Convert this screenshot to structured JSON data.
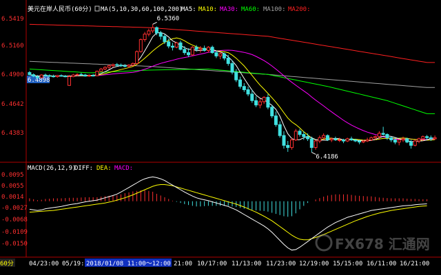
{
  "header": {
    "symbol": "美元在岸人民币(60分)",
    "ma_title": "MA(5,10,30,60,100,200)",
    "ma_entries": [
      {
        "label": "MA5:",
        "color": "#ffffff"
      },
      {
        "label": "MA10:",
        "color": "#ffff00"
      },
      {
        "label": "MA30:",
        "color": "#ff00ff"
      },
      {
        "label": "MA60:",
        "color": "#00ff00"
      },
      {
        "label": "MA100:",
        "color": "#a0a0a0"
      },
      {
        "label": "MA200:",
        "color": "#ff2020"
      }
    ]
  },
  "macd_header": {
    "title": "MACD(26,12,9)",
    "diff_label": "DIFF:",
    "dea_label": "DEA:",
    "macd_label": "MACD:"
  },
  "colors": {
    "up": "#ff3030",
    "down": "#40e0e0",
    "axis": "#b00000",
    "ma5": "#ffffff",
    "ma10": "#ffff00",
    "ma30": "#ff00ff",
    "ma60": "#00ff00",
    "ma100": "#a0a0a0",
    "ma200": "#ff2020",
    "diff": "#ffffff",
    "dea": "#ffff00"
  },
  "chart_data": [
    {
      "type": "candlestick",
      "title": "美元在岸人民币(60分)",
      "ylim": [
        6.412,
        6.5419
      ],
      "yticks": [
        "6.5419",
        "6.5160",
        "6.4900",
        "6.4642",
        "6.4383"
      ],
      "current_price_label": "6.4898",
      "annotations": [
        {
          "text": "6.5360",
          "x_index": 31,
          "value": 6.536,
          "type": "high"
        },
        {
          "text": "6.4186",
          "x_index": 71,
          "value": 6.4186,
          "type": "low"
        }
      ],
      "candles": [
        [
          6.4918,
          6.4932,
          6.4895,
          6.4898
        ],
        [
          6.4898,
          6.491,
          6.4875,
          6.4885
        ],
        [
          6.488,
          6.4895,
          6.486,
          6.487
        ],
        [
          6.487,
          6.4902,
          6.4865,
          6.4895
        ],
        [
          6.4895,
          6.4908,
          6.488,
          6.489
        ],
        [
          6.489,
          6.49,
          6.4878,
          6.4885
        ],
        [
          6.4885,
          6.4898,
          6.4872,
          6.488
        ],
        [
          6.488,
          6.4895,
          6.487,
          6.489
        ],
        [
          6.489,
          6.49,
          6.488,
          6.4885
        ],
        [
          6.4885,
          6.4895,
          6.4875,
          6.488
        ],
        [
          6.48,
          6.4895,
          6.4795,
          6.488
        ],
        [
          6.488,
          6.4905,
          6.4875,
          6.4895
        ],
        [
          6.4895,
          6.491,
          6.4885,
          6.49
        ],
        [
          6.49,
          6.4915,
          6.4888,
          6.4895
        ],
        [
          6.4895,
          6.4905,
          6.488,
          6.4885
        ],
        [
          6.4885,
          6.49,
          6.4878,
          6.4892
        ],
        [
          6.4892,
          6.4905,
          6.4882,
          6.4888
        ],
        [
          6.4888,
          6.4935,
          6.4885,
          6.493
        ],
        [
          6.493,
          6.496,
          6.4925,
          6.495
        ],
        [
          6.495,
          6.4975,
          6.494,
          6.4965
        ],
        [
          6.4965,
          6.499,
          6.495,
          6.498
        ],
        [
          6.498,
          6.5,
          6.4965,
          6.499
        ],
        [
          6.499,
          6.5005,
          6.497,
          6.4985
        ],
        [
          6.4985,
          6.5,
          6.497,
          6.498
        ],
        [
          6.498,
          6.4995,
          6.4965,
          6.4975
        ],
        [
          6.4975,
          6.4995,
          6.496,
          6.4985
        ],
        [
          6.4985,
          6.501,
          6.4975,
          6.5
        ],
        [
          6.5,
          6.512,
          6.4995,
          6.511
        ],
        [
          6.511,
          6.523,
          6.51,
          6.522
        ],
        [
          6.522,
          6.529,
          6.52,
          6.527
        ],
        [
          6.527,
          6.532,
          6.525,
          6.53
        ],
        [
          6.53,
          6.536,
          6.528,
          6.533
        ],
        [
          6.533,
          6.534,
          6.526,
          6.528
        ],
        [
          6.528,
          6.53,
          6.522,
          6.525
        ],
        [
          6.525,
          6.527,
          6.518,
          6.52
        ],
        [
          6.52,
          6.523,
          6.514,
          6.516
        ],
        [
          6.516,
          6.519,
          6.512,
          6.515
        ],
        [
          6.515,
          6.52,
          6.514,
          6.519
        ],
        [
          6.519,
          6.521,
          6.512,
          6.513
        ],
        [
          6.513,
          6.516,
          6.508,
          6.51
        ],
        [
          6.51,
          6.514,
          6.506,
          6.508
        ],
        [
          6.508,
          6.516,
          6.507,
          6.515
        ],
        [
          6.515,
          6.517,
          6.511,
          6.513
        ],
        [
          6.513,
          6.516,
          6.51,
          6.514
        ],
        [
          6.514,
          6.5165,
          6.511,
          6.512
        ],
        [
          6.512,
          6.516,
          6.51,
          6.515
        ],
        [
          6.515,
          6.5165,
          6.509,
          6.51
        ],
        [
          6.51,
          6.512,
          6.505,
          6.507
        ],
        [
          6.507,
          6.511,
          6.504,
          6.509
        ],
        [
          6.509,
          6.51,
          6.503,
          6.505
        ],
        [
          6.505,
          6.508,
          6.498,
          6.5
        ],
        [
          6.5,
          6.503,
          6.49,
          6.492
        ],
        [
          6.492,
          6.495,
          6.483,
          6.485
        ],
        [
          6.485,
          6.488,
          6.477,
          6.479
        ],
        [
          6.479,
          6.482,
          6.474,
          6.476
        ],
        [
          6.476,
          6.479,
          6.47,
          6.472
        ],
        [
          6.472,
          6.476,
          6.464,
          6.466
        ],
        [
          6.466,
          6.47,
          6.46,
          6.462
        ],
        [
          6.462,
          6.468,
          6.459,
          6.465
        ],
        [
          6.465,
          6.47,
          6.463,
          6.469
        ],
        [
          6.469,
          6.472,
          6.458,
          6.46
        ],
        [
          6.46,
          6.462,
          6.45,
          6.452
        ],
        [
          6.452,
          6.456,
          6.442,
          6.444
        ],
        [
          6.444,
          6.447,
          6.432,
          6.434
        ],
        [
          6.434,
          6.438,
          6.422,
          6.425
        ],
        [
          6.425,
          6.429,
          6.419,
          6.423
        ],
        [
          6.423,
          6.432,
          6.421,
          6.43
        ],
        [
          6.43,
          6.44,
          6.429,
          6.438
        ],
        [
          6.438,
          6.44,
          6.433,
          6.435
        ],
        [
          6.435,
          6.438,
          6.43,
          6.433
        ],
        [
          6.433,
          6.436,
          6.429,
          6.431
        ],
        [
          6.431,
          6.433,
          6.4186,
          6.423
        ],
        [
          6.423,
          6.43,
          6.421,
          6.429
        ],
        [
          6.429,
          6.434,
          6.427,
          6.432
        ],
        [
          6.432,
          6.436,
          6.43,
          6.434
        ],
        [
          6.434,
          6.435,
          6.429,
          6.43
        ],
        [
          6.43,
          6.432,
          6.428,
          6.431
        ],
        [
          6.431,
          6.433,
          6.429,
          6.43
        ],
        [
          6.43,
          6.432,
          6.428,
          6.43
        ],
        [
          6.43,
          6.431,
          6.427,
          6.429
        ],
        [
          6.429,
          6.432,
          6.428,
          6.431
        ],
        [
          6.431,
          6.433,
          6.429,
          6.43
        ],
        [
          6.43,
          6.431,
          6.428,
          6.429
        ],
        [
          6.429,
          6.43,
          6.426,
          6.428
        ],
        [
          6.428,
          6.43,
          6.427,
          6.429
        ],
        [
          6.429,
          6.432,
          6.428,
          6.43
        ],
        [
          6.43,
          6.433,
          6.429,
          6.432
        ],
        [
          6.432,
          6.434,
          6.43,
          6.433
        ],
        [
          6.433,
          6.438,
          6.431,
          6.436
        ],
        [
          6.436,
          6.442,
          6.434,
          6.435
        ],
        [
          6.435,
          6.436,
          6.43,
          6.432
        ],
        [
          6.432,
          6.433,
          6.428,
          6.43
        ],
        [
          6.43,
          6.432,
          6.426,
          6.428
        ],
        [
          6.428,
          6.431,
          6.425,
          6.43
        ],
        [
          6.43,
          6.433,
          6.428,
          6.431
        ],
        [
          6.431,
          6.432,
          6.427,
          6.428
        ],
        [
          6.428,
          6.43,
          6.422,
          6.425
        ],
        [
          6.425,
          6.43,
          6.424,
          6.429
        ],
        [
          6.429,
          6.432,
          6.427,
          6.431
        ],
        [
          6.431,
          6.434,
          6.429,
          6.433
        ],
        [
          6.433,
          6.4345,
          6.43,
          6.432
        ],
        [
          6.432,
          6.434,
          6.429,
          6.431
        ],
        [
          6.431,
          6.434,
          6.43,
          6.432
        ]
      ],
      "moving_averages": {
        "ma100": [
          [
            6.502,
            0
          ],
          [
            6.4975,
            30
          ],
          [
            6.49,
            60
          ],
          [
            6.478,
            100
          ]
        ],
        "ma200": [
          [
            6.536,
            0
          ],
          [
            6.533,
            30
          ],
          [
            6.525,
            60
          ],
          [
            6.501,
            100
          ]
        ],
        "ma60": [
          [
            6.495,
            0
          ],
          [
            6.4915,
            15
          ],
          [
            6.494,
            30
          ],
          [
            6.495,
            45
          ],
          [
            6.49,
            60
          ],
          [
            6.479,
            75
          ],
          [
            6.466,
            90
          ],
          [
            6.454,
            100
          ]
        ]
      }
    },
    {
      "type": "macd",
      "title": "MACD(26,12,9)",
      "ylim": [
        -0.018,
        0.0095
      ],
      "yticks": [
        "0.0095",
        "0.0055",
        "0.0014",
        "-0.0027",
        "-0.0068",
        "-0.0109",
        "-0.0150"
      ],
      "diff": [
        -0.0028,
        -0.003,
        -0.0032,
        -0.003,
        -0.0026,
        -0.0024,
        -0.0022,
        -0.002,
        -0.0018,
        -0.0015,
        -0.0012,
        -0.001,
        -0.0008,
        -0.0005,
        -0.0002,
        0.0,
        0.0002,
        0.0004,
        0.0008,
        0.0012,
        0.0016,
        0.002,
        0.0025,
        0.0032,
        0.004,
        0.0048,
        0.0056,
        0.0064,
        0.0072,
        0.0078,
        0.0082,
        0.0085,
        0.0082,
        0.0078,
        0.0072,
        0.0064,
        0.0056,
        0.0048,
        0.004,
        0.0032,
        0.0025,
        0.0018,
        0.0012,
        0.0008,
        0.0005,
        0.0002,
        -0.0002,
        -0.0006,
        -0.001,
        -0.0014,
        -0.0018,
        -0.0024,
        -0.003,
        -0.0038,
        -0.0046,
        -0.0054,
        -0.0062,
        -0.007,
        -0.0078,
        -0.0086,
        -0.0096,
        -0.0108,
        -0.0122,
        -0.0136,
        -0.015,
        -0.0162,
        -0.017,
        -0.0168,
        -0.016,
        -0.015,
        -0.014,
        -0.013,
        -0.012,
        -0.011,
        -0.01,
        -0.009,
        -0.0082,
        -0.0074,
        -0.0068,
        -0.0062,
        -0.0056,
        -0.0052,
        -0.0048,
        -0.0044,
        -0.004,
        -0.0036,
        -0.0032,
        -0.003,
        -0.0028,
        -0.0026,
        -0.0024,
        -0.0022,
        -0.002,
        -0.0018,
        -0.0016,
        -0.0015,
        -0.0014,
        -0.0012,
        -0.0011,
        -0.001,
        -0.0009
      ],
      "dea": [
        -0.0038,
        -0.0037,
        -0.0036,
        -0.0035,
        -0.0034,
        -0.0033,
        -0.0032,
        -0.003,
        -0.0028,
        -0.0026,
        -0.0024,
        -0.0022,
        -0.002,
        -0.0018,
        -0.0016,
        -0.0014,
        -0.0012,
        -0.001,
        -0.0008,
        -0.0006,
        -0.0003,
        0.0,
        0.0004,
        0.0008,
        0.0012,
        0.0017,
        0.0022,
        0.0028,
        0.0034,
        0.004,
        0.0046,
        0.0052,
        0.0056,
        0.0058,
        0.0058,
        0.0056,
        0.0054,
        0.005,
        0.0046,
        0.0042,
        0.0038,
        0.0034,
        0.003,
        0.0026,
        0.0022,
        0.0018,
        0.0014,
        0.001,
        0.0006,
        0.0002,
        -0.0002,
        -0.0006,
        -0.001,
        -0.0015,
        -0.002,
        -0.0026,
        -0.0032,
        -0.0038,
        -0.0045,
        -0.0052,
        -0.006,
        -0.0068,
        -0.0078,
        -0.0088,
        -0.0098,
        -0.0108,
        -0.0118,
        -0.0126,
        -0.0132,
        -0.0134,
        -0.0134,
        -0.013,
        -0.0126,
        -0.0121,
        -0.0116,
        -0.011,
        -0.0104,
        -0.0098,
        -0.0092,
        -0.0086,
        -0.008,
        -0.0074,
        -0.0068,
        -0.0063,
        -0.0058,
        -0.0053,
        -0.0049,
        -0.0045,
        -0.0041,
        -0.0038,
        -0.0035,
        -0.0032,
        -0.003,
        -0.0028,
        -0.0026,
        -0.0024,
        -0.0022,
        -0.002,
        -0.0018,
        -0.0017,
        -0.0016
      ]
    }
  ],
  "x_axis": {
    "left_label": "60分",
    "labels": [
      "04/23:00",
      "05/19:0",
      "2018/01/08  11:00～12:00",
      "21:00",
      "10/17:00",
      "11/13:00",
      "11/23:00",
      "12/19:00",
      "15/15:00",
      "16/11:00",
      "16/21:00"
    ]
  },
  "watermark": {
    "text": "FX678 汇通网"
  }
}
